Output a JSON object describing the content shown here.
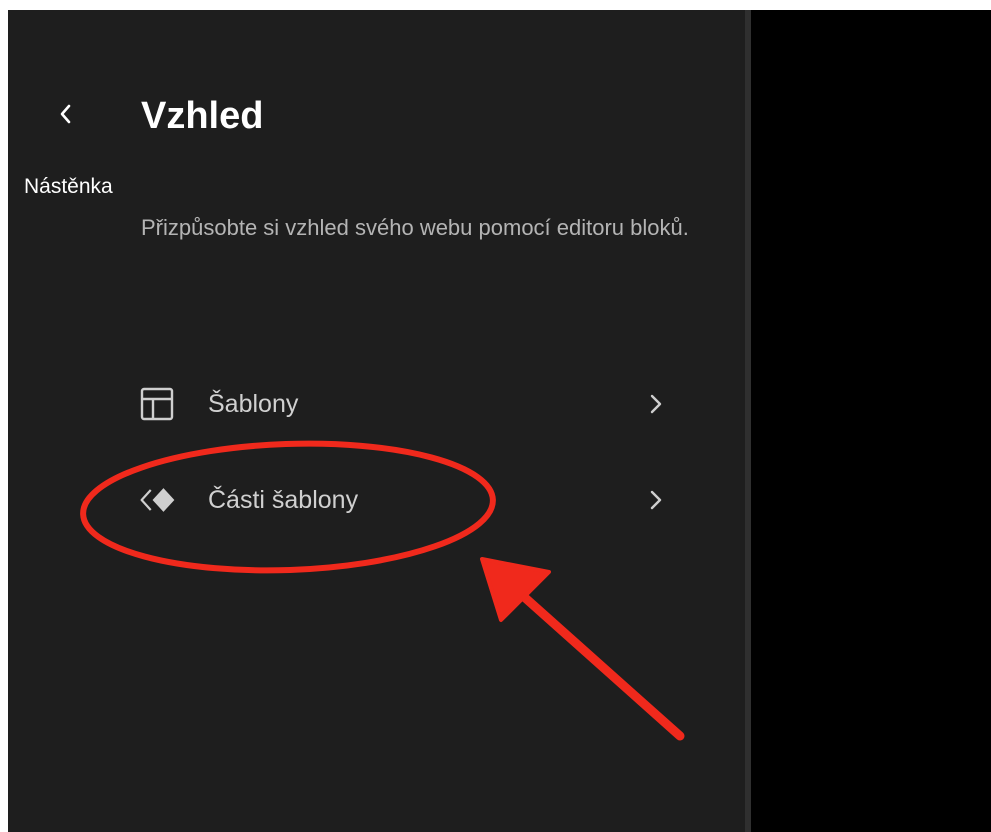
{
  "header": {
    "title": "Vzhled",
    "back_icon": "chevron-left-icon"
  },
  "dashboard_link": {
    "label": "Nástěnka"
  },
  "description": "Přizpůsobte si vzhled svého webu pomocí editoru bloků.",
  "nav_items": [
    {
      "label": "Šablony",
      "icon": "layout-icon",
      "chevron": "chevron-right-icon"
    },
    {
      "label": "Části šablony",
      "icon": "symbol-diamond-icon",
      "chevron": "chevron-right-icon"
    }
  ],
  "colors": {
    "sidebar_bg": "#1e1e1e",
    "canvas_bg": "#000000",
    "title": "#ffffff",
    "description": "#b4b4b4",
    "annotation_red": "#f0291c"
  }
}
